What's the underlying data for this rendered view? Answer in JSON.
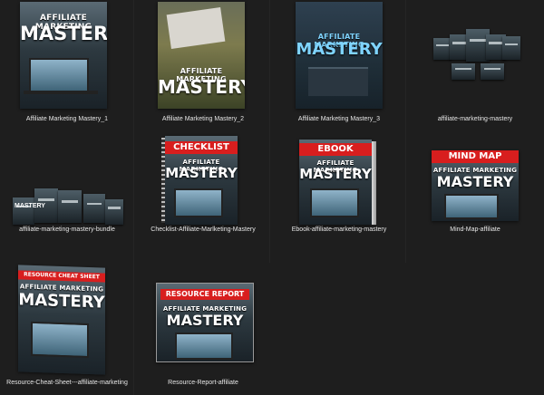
{
  "files": [
    {
      "name": "Affiliate Marketing Mastery_1",
      "cover_title_top": "AFFILIATE MARKETING",
      "cover_title_main": "MASTERY"
    },
    {
      "name": "Affiliate Marketing Mastery_2",
      "cover_title_top": "AFFILIATE MARKETING",
      "cover_title_main": "MASTERY"
    },
    {
      "name": "Affiliate Marketing Mastery_3",
      "cover_title_top": "AFFILIATE MARKETING",
      "cover_title_main": "MASTERY"
    },
    {
      "name": "affiliate-marketing-mastery"
    },
    {
      "name": "affiliate-marketing-mastery-bundle",
      "cover_title_main": "MASTERY"
    },
    {
      "name": "Checklist-Affiliate-Marlketing-Mastery",
      "banner": "CHECKLIST",
      "cover_title_top": "AFFILIATE MARKETING",
      "cover_title_main": "MASTERY"
    },
    {
      "name": "Ebook-affiliate-marketing-mastery",
      "banner": "EBOOK",
      "cover_title_top": "AFFILIATE MARKETING",
      "cover_title_main": "MASTERY"
    },
    {
      "name": "Mind-Map-affiliate",
      "banner": "MIND MAP",
      "cover_title_top": "AFFILIATE MARKETING",
      "cover_title_main": "MASTERY"
    },
    {
      "name": "Resource-Cheat-Sheet---affiliate-marketing",
      "banner": "RESOURCE CHEAT SHEET",
      "cover_title_top": "AFFILIATE MARKETING",
      "cover_title_main": "MASTERY"
    },
    {
      "name": "Resource-Report-affiliate",
      "banner": "RESOURCE REPORT",
      "cover_title_top": "AFFILIATE MARKETING",
      "cover_title_main": "MASTERY"
    }
  ],
  "colors": {
    "background": "#1e1e1e",
    "banner_red": "#d81e1e",
    "caption_text": "#e6e6e6"
  }
}
